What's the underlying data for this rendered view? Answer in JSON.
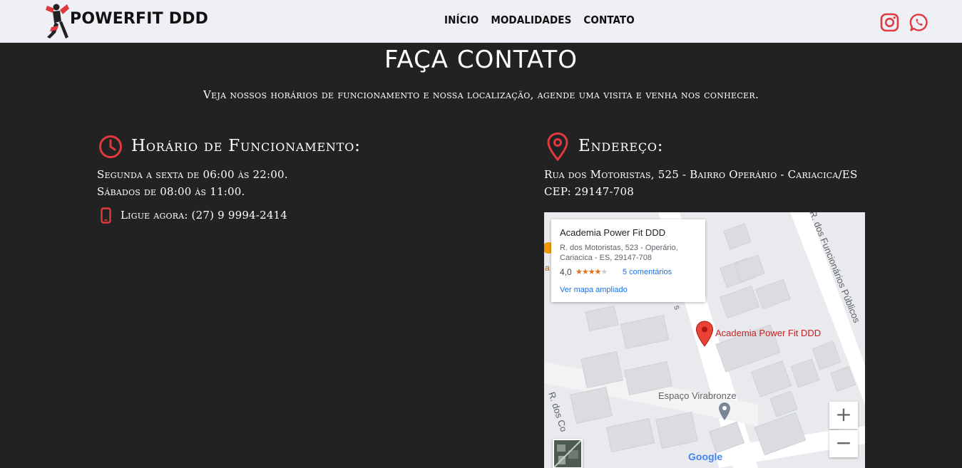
{
  "header": {
    "brand": "POWERFIT DDD",
    "nav": [
      "INÍCIO",
      "MODALIDADES",
      "CONTATO"
    ],
    "social_icons": [
      "instagram-icon",
      "whatsapp-icon"
    ],
    "accent_color": "#e0393e"
  },
  "contact": {
    "title": "FAÇA CONTATO",
    "subtitle": "Veja nossos horários de funcionamento e nossa localização, agende uma visita e venha nos conhecer."
  },
  "hours": {
    "title": "Horário de Funcionamento:",
    "weekdays": "Segunda a sexta de 06:00 às 22:00.",
    "saturday": "Sábados de 08:00 às 11:00.",
    "phone": "Ligue agora: (27) 9 9994-2414"
  },
  "address": {
    "title": "Endereço:",
    "line1": "Rua dos Motoristas, 525 - Bairro Operário - Cariacica/ES",
    "line2": "CEP: 29147-708"
  },
  "map": {
    "card_title": "Academia Power Fit DDD",
    "card_address": "R. dos Motoristas, 523 - Operário, Cariacica - ES, 29147-708",
    "rating": "4,0",
    "stars": "★★★★★",
    "rating_value": 4.0,
    "reviews": "5 comentários",
    "view_larger": "Ver mapa ampliado",
    "pin_label": "Academia Power Fit DDD",
    "poi_label": "Espaço Virabronze",
    "street1": "R. dos Funcionários Públicos",
    "street2": "R. dos Co",
    "google": "Google",
    "zoom_in": "+",
    "zoom_out": "−"
  }
}
